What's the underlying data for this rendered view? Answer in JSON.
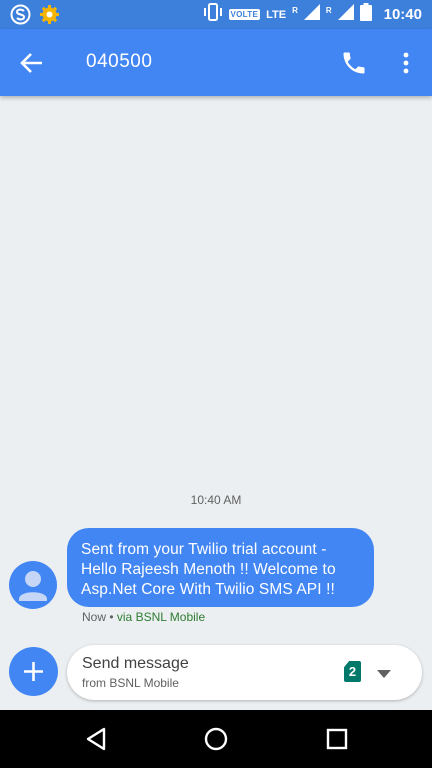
{
  "status_bar": {
    "time": "10:40",
    "network_type": "LTE",
    "volte": "VOLTE",
    "roaming_1": "R",
    "roaming_2": "R",
    "icons": [
      "app-s-icon",
      "settings-gear-icon",
      "vibrate-icon",
      "signal-icon",
      "battery-icon"
    ],
    "accent": "#3d80dc"
  },
  "app_bar": {
    "title": "040500",
    "icons": [
      "back-arrow-icon",
      "phone-icon",
      "more-vert-icon"
    ],
    "color": "#4286f4"
  },
  "conversation": {
    "timestamp": "10:40 AM",
    "messages": [
      {
        "text": "Sent from your Twilio trial account - Hello Rajeesh Menoth !! Welcome to Asp.Net Core With Twilio SMS API !!",
        "meta_time": "Now",
        "meta_separator": " • ",
        "meta_via": "via BSNL Mobile",
        "avatar_icon": "person-icon"
      }
    ]
  },
  "composer": {
    "placeholder": "Send message",
    "sub_label": "from BSNL Mobile",
    "sim_slot": "2",
    "icons": [
      "add-icon",
      "sim-card-icon",
      "dropdown-arrow-icon"
    ]
  },
  "nav_bar": {
    "icons": [
      "nav-back-icon",
      "nav-home-icon",
      "nav-recents-icon"
    ]
  }
}
